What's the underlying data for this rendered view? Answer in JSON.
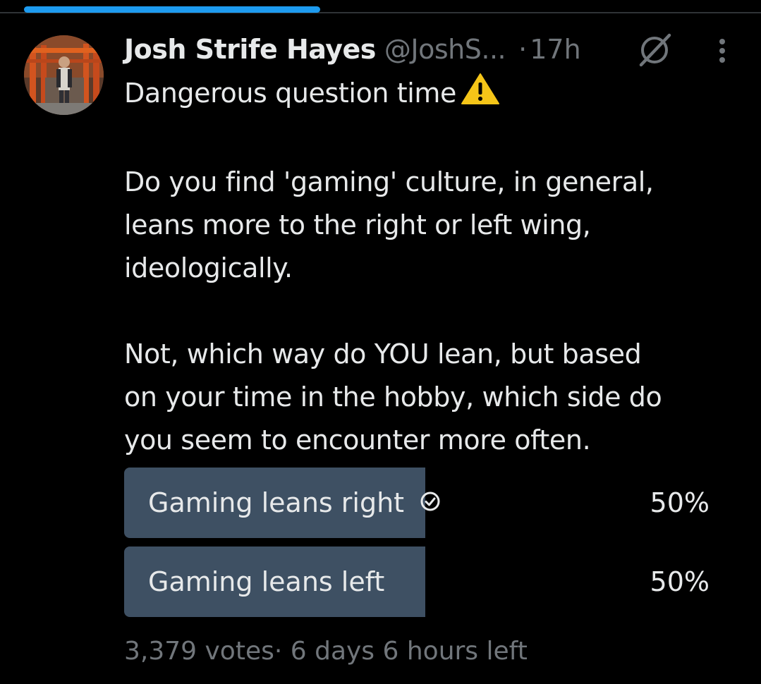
{
  "colors": {
    "background": "#000000",
    "text": "#e7e9ea",
    "muted": "#71767b",
    "accent": "#1d9bf0",
    "poll_bar": "#3e5063"
  },
  "loading_bar": {
    "progress": 0.42
  },
  "tweet": {
    "display_name": "Josh Strife Hayes",
    "handle": "@JoshS...",
    "separator": "·",
    "time": "17h",
    "avatar_icon": "profile-photo",
    "grok_icon": "grok-icon",
    "more_icon": "more-options-icon",
    "text_lines": {
      "line1": "Dangerous question time",
      "line2": "Do you find 'gaming' culture, in general,",
      "line3": "leans more to the right or left wing,",
      "line4": "ideologically.",
      "line5": "Not, which way do YOU lean, but based",
      "line6": "on your time in the hobby, which side do",
      "line7": "you seem to encounter more often."
    },
    "warning_icon": "warning-emoji"
  },
  "poll": {
    "options": [
      {
        "label": "Gaming leans right",
        "percent_text": "50%",
        "share": 0.5,
        "selected": true
      },
      {
        "label": "Gaming leans left",
        "percent_text": "50%",
        "share": 0.5,
        "selected": false
      }
    ],
    "check_icon": "check-circle-icon",
    "footer": "3,379 votes· 6 days 6 hours left"
  }
}
